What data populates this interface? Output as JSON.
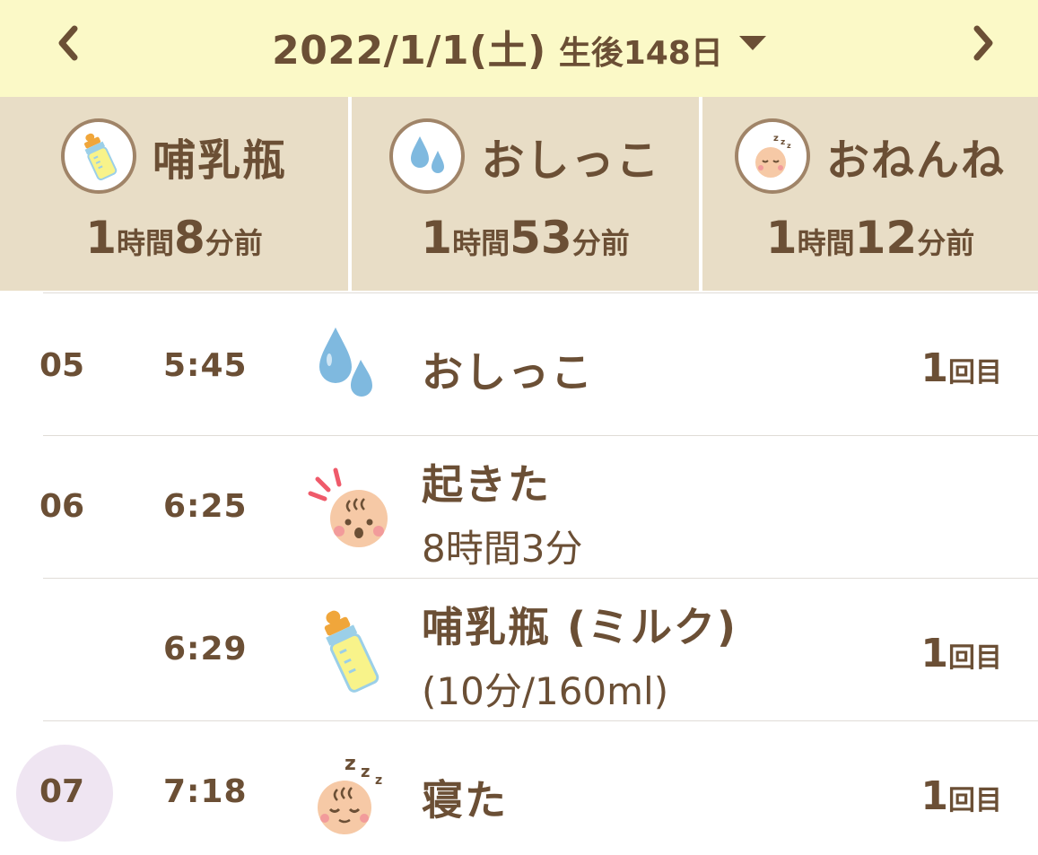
{
  "header": {
    "date": "2022/1/1(土)",
    "age": "生後148日",
    "prev_icon": "chevron-left-icon",
    "next_icon": "chevron-right-icon",
    "dropdown_icon": "caret-down-icon"
  },
  "summary": [
    {
      "title": "哺乳瓶",
      "icon": "baby-bottle-icon",
      "hours": "1",
      "hours_unit": "時間",
      "minutes": "8",
      "minutes_unit": "分前"
    },
    {
      "title": "おしっこ",
      "icon": "water-drops-icon",
      "hours": "1",
      "hours_unit": "時間",
      "minutes": "53",
      "minutes_unit": "分前"
    },
    {
      "title": "おねんね",
      "icon": "sleeping-baby-icon",
      "hours": "1",
      "hours_unit": "時間",
      "minutes": "12",
      "minutes_unit": "分前"
    }
  ],
  "timeline": [
    {
      "hour": "05",
      "time": "5:45",
      "icon": "water-drops-icon",
      "title": "おしっこ",
      "count": "1",
      "count_unit": "回目"
    },
    {
      "hour": "06",
      "time": "6:25",
      "icon": "awake-baby-icon",
      "title": "起きた",
      "detail": "8時間3分"
    },
    {
      "hour": "",
      "time": "6:29",
      "icon": "baby-bottle-icon",
      "title": "哺乳瓶 (ミルク)",
      "detail": "(10分/160ml)",
      "count": "1",
      "count_unit": "回目"
    },
    {
      "hour": "07",
      "time": "7:18",
      "icon": "sleeping-baby-icon",
      "title": "寝た",
      "count": "1",
      "count_unit": "回目"
    }
  ],
  "colors": {
    "header_bg": "#fbf9c7",
    "card_bg": "#e8ddc6",
    "text_brown": "#6b4f35",
    "drop_blue": "#7fb9df",
    "current_hour_highlight": "#efe5f2"
  }
}
